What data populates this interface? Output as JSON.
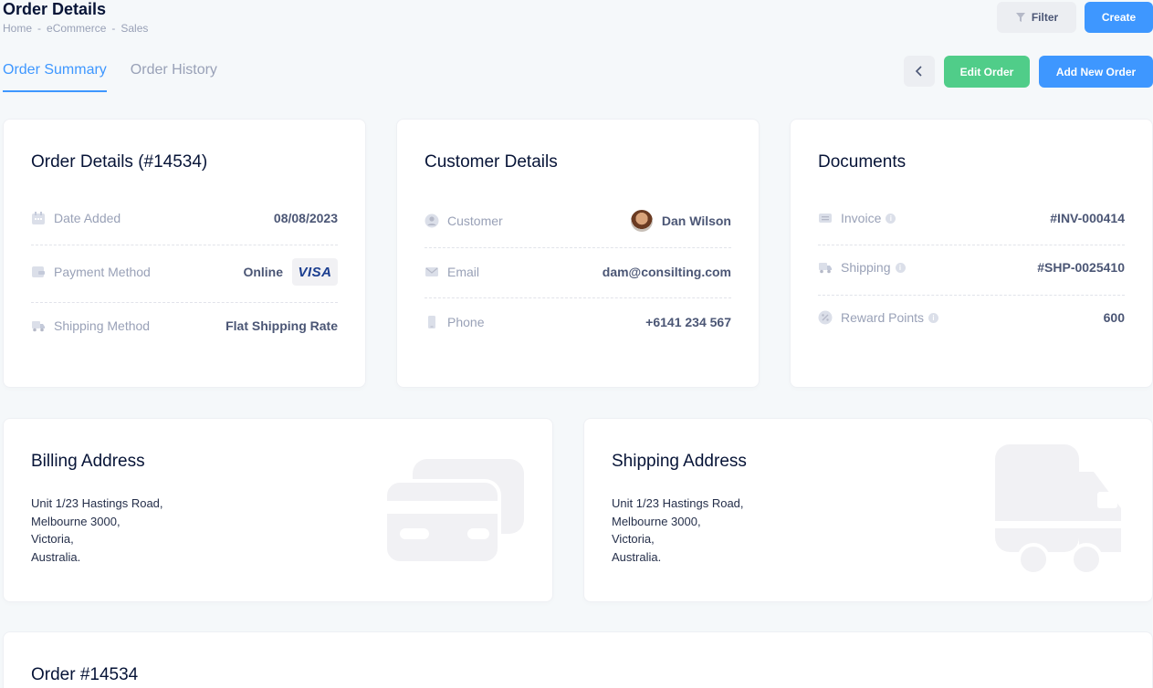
{
  "header": {
    "title": "Order Details",
    "breadcrumb": [
      "Home",
      "eCommerce",
      "Sales"
    ],
    "breadcrumb_sep": "-",
    "filter_label": "Filter",
    "create_label": "Create"
  },
  "tabs": [
    {
      "label": "Order Summary",
      "active": true
    },
    {
      "label": "Order History",
      "active": false
    }
  ],
  "actions": {
    "back_icon": "chevron-left-icon",
    "edit_label": "Edit Order",
    "add_label": "Add New Order"
  },
  "order_details": {
    "title": "Order Details (#14534)",
    "date_label": "Date Added",
    "date_value": "08/08/2023",
    "payment_label": "Payment Method",
    "payment_value": "Online",
    "payment_brand": "VISA",
    "shipping_label": "Shipping Method",
    "shipping_value": "Flat Shipping Rate"
  },
  "customer_details": {
    "title": "Customer Details",
    "customer_label": "Customer",
    "customer_value": "Dan Wilson",
    "email_label": "Email",
    "email_value": "dam@consilting.com",
    "phone_label": "Phone",
    "phone_value": "+6141 234 567"
  },
  "documents": {
    "title": "Documents",
    "invoice_label": "Invoice",
    "invoice_value": "#INV-000414",
    "shipping_label": "Shipping",
    "shipping_value": "#SHP-0025410",
    "reward_label": "Reward Points",
    "reward_value": "600"
  },
  "billing": {
    "title": "Billing Address",
    "line1": "Unit 1/23 Hastings Road,",
    "line2": "Melbourne 3000,",
    "line3": "Victoria,",
    "line4": "Australia."
  },
  "shipping": {
    "title": "Shipping Address",
    "line1": "Unit 1/23 Hastings Road,",
    "line2": "Melbourne 3000,",
    "line3": "Victoria,",
    "line4": "Australia."
  },
  "order_items": {
    "title": "Order #14534"
  },
  "colors": {
    "primary": "#3e97ff",
    "success": "#50cd89",
    "muted": "#99a1b7"
  }
}
